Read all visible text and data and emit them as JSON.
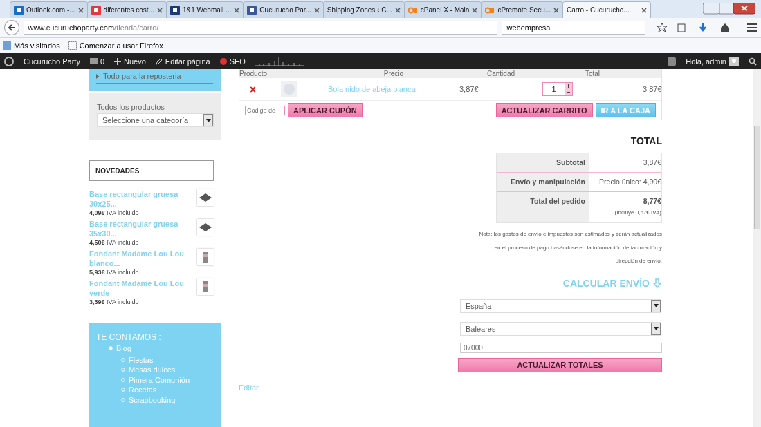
{
  "tabs": [
    {
      "label": "Outlook.com -...",
      "kind": "mail",
      "selected": false
    },
    {
      "label": "diferentes cost...",
      "kind": "letter",
      "selected": false
    },
    {
      "label": "1&1 Webmail ...",
      "kind": "box",
      "selected": false
    },
    {
      "label": "Cucurucho Par...",
      "kind": "social",
      "selected": false
    },
    {
      "label": "Shipping Zones ‹ C...",
      "kind": "none",
      "selected": false
    },
    {
      "label": "cPanel X - Main",
      "kind": "panel",
      "selected": false
    },
    {
      "label": "cPremote Secu...",
      "kind": "panel",
      "selected": false
    },
    {
      "label": "Carro - Cucurucho...",
      "kind": "none",
      "selected": true
    }
  ],
  "address_bar": {
    "host": "www.cucuruchoparty.com",
    "path": "/tienda/carro/"
  },
  "search_box": {
    "value": "webempresa"
  },
  "bookmarks": [
    "Más visitados",
    "Comenzar a usar Firefox"
  ],
  "admin_bar": {
    "site": "Cucurucho Party",
    "comments": "0",
    "new": "Nuevo",
    "edit": "Editar página",
    "seo": "SEO",
    "greeting": "Hola, admin"
  },
  "sidebar": {
    "menu_item": "Todo para la reposteria",
    "products_widget": {
      "title": "Todos los productos",
      "select": "Seleccione una categoría"
    },
    "news_title": "NOVEDADES",
    "news": [
      {
        "name": "Base rectangular gruesa 30x25...",
        "price": "4,09€",
        "tax": "IVA incluido",
        "kind": "tray"
      },
      {
        "name": "Base rectangular gruesa 35x30...",
        "price": "4,50€",
        "tax": "IVA incluido",
        "kind": "tray"
      },
      {
        "name": "Fondant Madame Lou Lou blanco...",
        "price": "5,93€",
        "tax": "IVA incluido",
        "kind": "pack"
      },
      {
        "name": "Fondant Madame Lou Lou verde",
        "price": "3,39€",
        "tax": "IVA incluido",
        "kind": "pack"
      }
    ],
    "about": {
      "title": "TE CONTAMOS :",
      "item": "Blog",
      "children": [
        "Fiestas",
        "Mesas dulces",
        "Pimera Comunión",
        "Recetas",
        "Scrapbooking"
      ]
    }
  },
  "cart": {
    "columns": [
      "Producto",
      "Precio",
      "Cantidad",
      "Total"
    ],
    "rows": [
      {
        "product": "Bola nido de abeja blanca",
        "price": "3,87€",
        "quantity": "1",
        "total": "3,87€"
      }
    ],
    "coupon_placeholder": "Codigo de",
    "apply": "APLICAR CUPÓN",
    "update": "ACTUALIZAR CARRITO",
    "checkout": "IR A LA CAJA"
  },
  "totals": {
    "title": "TOTAL",
    "rows": [
      {
        "label": "Subtotal",
        "value": "3,87€"
      },
      {
        "label": "Envío y manipulación",
        "value": "Precio único: 4,90€"
      },
      {
        "label": "Total del pedido",
        "value": "8,77€",
        "note": "(Incluye 0,67€ IVA)"
      }
    ],
    "note": [
      "Nota: los gastos de envío e impuestos son estimados y serán actualizados",
      "en el proceso de pago basándose en la información de facturación y",
      "dirección de envío."
    ]
  },
  "shipping": {
    "title": "CALCULAR ENVÍO",
    "country": "España",
    "region": "Baleares",
    "postcode": "07000",
    "button": "ACTUALIZAR TOTALES"
  },
  "edit_link": "Editar"
}
